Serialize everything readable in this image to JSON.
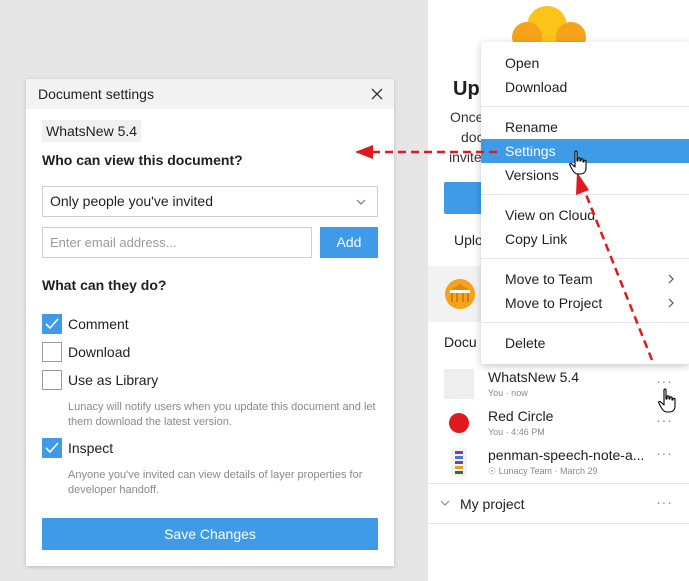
{
  "right_panel": {
    "heading_partial": "Upl",
    "body_lines": [
      "Once",
      "doc",
      "invite"
    ],
    "section_upload": "Uplo",
    "section_documents": "Docu",
    "documents": [
      {
        "name": "WhatsNew 5.4",
        "meta": "You · now"
      },
      {
        "name": "Red Circle",
        "meta": "You · 4:46 PM"
      },
      {
        "name": "penman-speech-note-a...",
        "meta": "Lunacy Team · March 29"
      }
    ],
    "project": {
      "name": "My project"
    },
    "dots": "···"
  },
  "context_menu": {
    "items": [
      {
        "label": "Open"
      },
      {
        "label": "Download"
      },
      {
        "label": "Rename"
      },
      {
        "label": "Settings"
      },
      {
        "label": "Versions"
      },
      {
        "label": "View on Cloud"
      },
      {
        "label": "Copy Link"
      },
      {
        "label": "Move to Team"
      },
      {
        "label": "Move to Project"
      },
      {
        "label": "Delete"
      }
    ],
    "active_item": "Settings",
    "submenu_arrow": "›"
  },
  "dialog": {
    "title": "Document settings",
    "doc_name": "WhatsNew 5.4",
    "view_question": "Who can view this document?",
    "view_select": "Only people you've invited",
    "email_placeholder": "Enter email address...",
    "add_label": "Add",
    "can_do_question": "What can they do?",
    "permissions": [
      {
        "label": "Comment",
        "checked": true
      },
      {
        "label": "Download",
        "checked": false
      },
      {
        "label": "Use as Library",
        "checked": false
      },
      {
        "label": "Inspect",
        "checked": true
      }
    ],
    "library_hint": "Lunacy will notify users when you update this document and let them download the latest version.",
    "inspect_hint": "Anyone you've invited can view details of layer properties for developer handoff.",
    "save_label": "Save Changes"
  },
  "colors": {
    "accent": "#3f9be8",
    "annotation_red": "#e0191e",
    "logo_orange": "#f7a21b",
    "logo_yellow": "#fcc419"
  },
  "icons": [
    "close-icon",
    "chevron-down-icon",
    "check-icon",
    "more-dots-icon",
    "chevron-right-icon",
    "hand-cursor-icon"
  ]
}
